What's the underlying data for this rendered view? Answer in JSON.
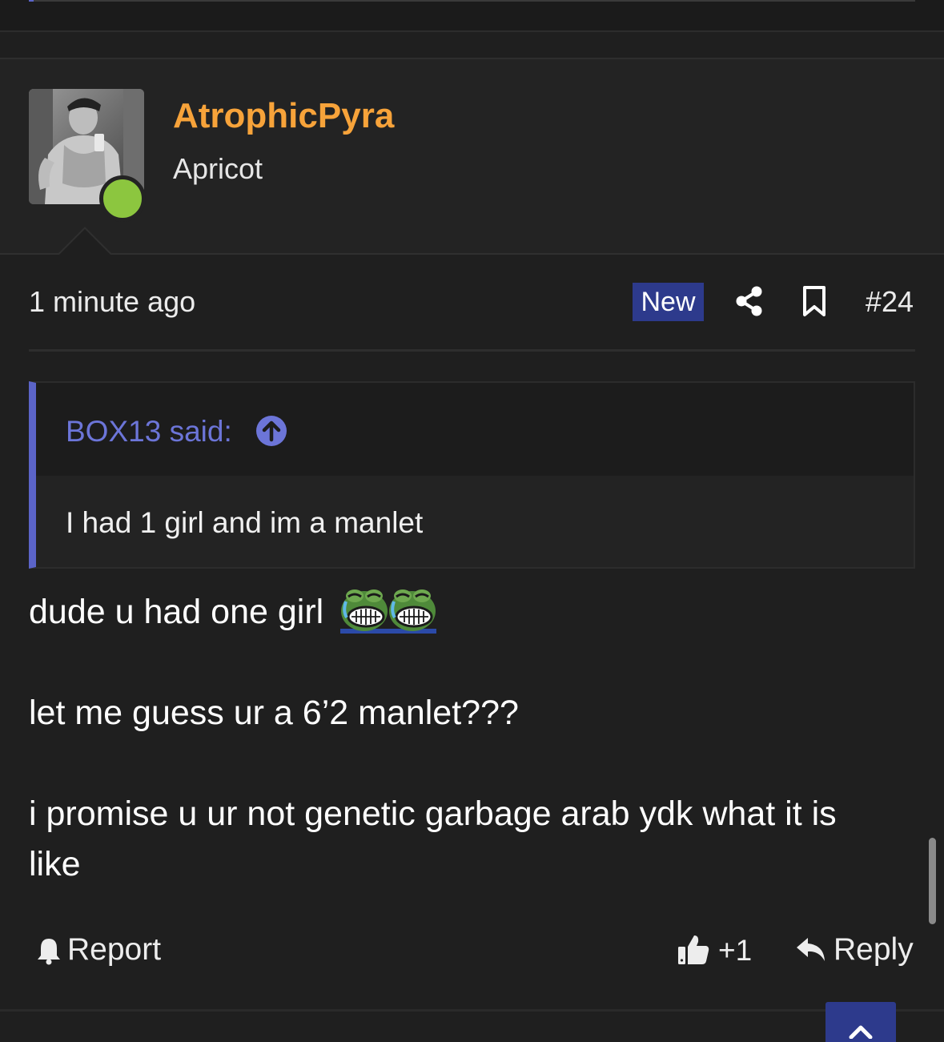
{
  "post": {
    "username": "AtrophicPyra",
    "user_title": "Apricot",
    "online_status": "online",
    "time": "1 minute ago",
    "badge": "New",
    "post_number": "#24",
    "quote": {
      "author": "BOX13 said:",
      "text": "I had 1 girl and im a manlet"
    },
    "message": {
      "line1": "dude u had one girl",
      "line2": "let me guess ur a 6’2 manlet???",
      "line3a": "i promise u ur not genetic garbage arab ydk what it is",
      "line3b": "like"
    },
    "actions": {
      "report": "Report",
      "like_count": "+1",
      "reply": "Reply"
    }
  },
  "colors": {
    "background": "#1f1f1f",
    "username": "#f7a33a",
    "accent": "#5b64c8",
    "badge": "#2d3a8c",
    "online": "#8cc63f"
  },
  "icons": [
    "share-icon",
    "bookmark-icon",
    "quote-jump-arrow-icon",
    "bell-icon",
    "thumbs-up-icon",
    "reply-arrow-icon",
    "chevron-up-icon",
    "emoji-laughing-frog-icon"
  ]
}
